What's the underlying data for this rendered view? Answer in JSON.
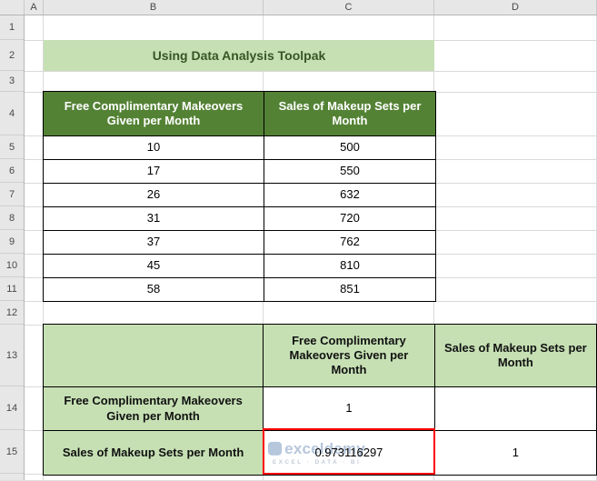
{
  "sheet": {
    "column_headers": [
      "A",
      "B",
      "C",
      "D"
    ],
    "row_headers": [
      "1",
      "2",
      "3",
      "4",
      "5",
      "6",
      "7",
      "8",
      "9",
      "10",
      "11",
      "12",
      "13",
      "14",
      "15"
    ]
  },
  "banner": {
    "title": "Using Data Analysis Toolpak"
  },
  "data_table": {
    "headers": [
      "Free Complimentary Makeovers Given per Month",
      "Sales of Makeup Sets per Month"
    ],
    "rows": [
      [
        "10",
        "500"
      ],
      [
        "17",
        "550"
      ],
      [
        "26",
        "632"
      ],
      [
        "31",
        "720"
      ],
      [
        "37",
        "762"
      ],
      [
        "45",
        "810"
      ],
      [
        "58",
        "851"
      ]
    ]
  },
  "correlation_table": {
    "col_headers": [
      "",
      "Free Complimentary Makeovers Given per Month",
      "Sales of Makeup Sets per Month"
    ],
    "rows": [
      {
        "label": "Free Complimentary Makeovers Given per Month",
        "c1": "1",
        "c2": ""
      },
      {
        "label": "Sales of Makeup Sets per Month",
        "c1": "0.973116297",
        "c2": "1"
      }
    ]
  },
  "watermark": {
    "brand": "exceldemy",
    "tagline": "EXCEL · DATA · BI"
  },
  "colors": {
    "header_green": "#548235",
    "light_green": "#C6E0B4",
    "banner_text": "#375623",
    "highlight_red": "#FF0000"
  }
}
